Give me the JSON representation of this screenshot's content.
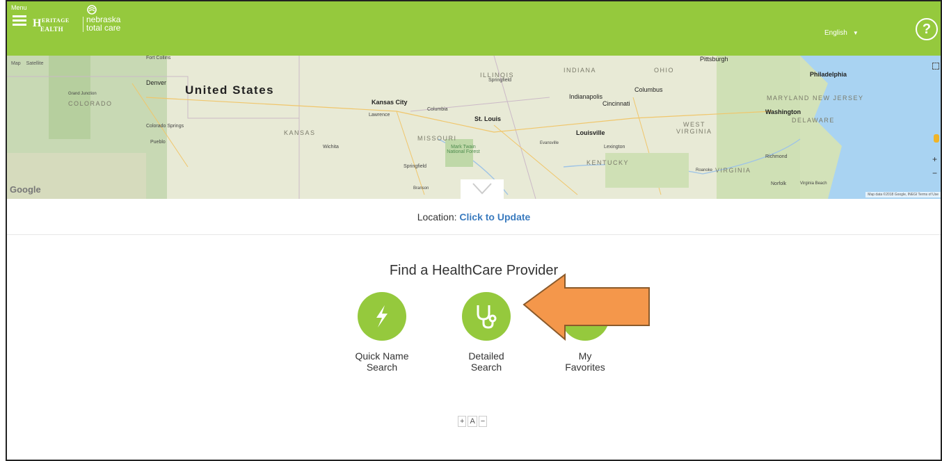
{
  "header": {
    "menu_label": "Menu",
    "brand_heritage_top": "ERITAGE",
    "brand_heritage_bottom": "EALTH",
    "brand_heritage_initial": "H",
    "brand_nebraska_line1": "nebraska",
    "brand_nebraska_line2": "total care",
    "language": "English",
    "help_label": "?",
    "accent_color": "#95c93d"
  },
  "map": {
    "type_map": "Map",
    "type_satellite": "Satellite",
    "country_label": "United States",
    "states": [
      "COLORADO",
      "KANSAS",
      "MISSOURI",
      "ILLINOIS",
      "INDIANA",
      "OHIO",
      "KENTUCKY",
      "WEST",
      "VIRGINIA",
      "VIRGINIA",
      "MARYLAND",
      "NEW JERSEY",
      "DELAWARE"
    ],
    "cities": [
      "Denver",
      "Grand Junction",
      "Colorado Springs",
      "Pueblo",
      "Fort Collins",
      "Kansas City",
      "Lawrence",
      "Columbia",
      "Wichita",
      "St. Louis",
      "Springfield",
      "Springfield",
      "Branson",
      "Indianapolis",
      "Columbus",
      "Cincinnati",
      "Louisville",
      "Lexington",
      "Evansville",
      "Pittsburgh",
      "Philadelphia",
      "Washington",
      "Richmond",
      "Roanoke",
      "Norfolk",
      "Virginia Beach"
    ],
    "forest_label": "Mark Twain National Forest",
    "google_label": "Google",
    "attribution": "Map data ©2018 Google, INEGI  Terms of Use",
    "zoom_in": "+",
    "zoom_out": "−"
  },
  "location": {
    "prefix": "Location:",
    "link": "Click to Update"
  },
  "find": {
    "title": "Find a HealthCare Provider",
    "options": [
      {
        "label_line1": "Quick Name",
        "label_line2": "Search",
        "icon": "lightning-icon"
      },
      {
        "label_line1": "Detailed",
        "label_line2": "Search",
        "icon": "stethoscope-icon"
      },
      {
        "label_line1": "My",
        "label_line2": "Favorites",
        "icon": "star-icon"
      }
    ],
    "font_controls": [
      "+",
      "A",
      "−"
    ]
  },
  "annotation": {
    "arrow_color": "#f4974b",
    "arrow_border": "#8a5a2b"
  }
}
